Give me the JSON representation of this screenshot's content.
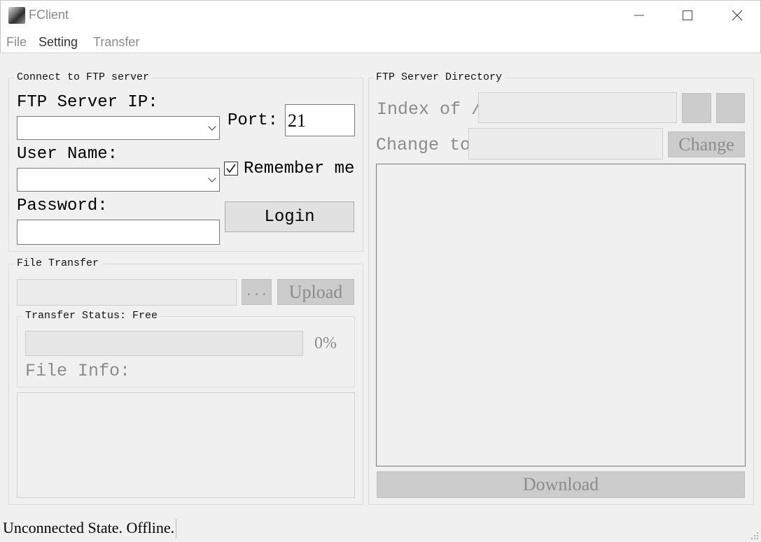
{
  "window": {
    "title": "FClient"
  },
  "menu": {
    "file": "File",
    "setting": "Setting",
    "transfer": "Transfer"
  },
  "connect": {
    "group_title": "Connect to FTP server",
    "ip_label": "FTP Server IP:",
    "ip_value": "",
    "port_label": "Port:",
    "port_value": "21",
    "username_label": "User Name:",
    "username_value": "",
    "remember_label": "Remember me",
    "remember_checked": true,
    "password_label": "Password:",
    "password_value": "",
    "login_label": "Login"
  },
  "file_transfer": {
    "group_title": "File Transfer",
    "file_path_value": "",
    "browse_label": "...",
    "upload_label": "Upload",
    "status_group_title": "Transfer Status: Free",
    "progress_percent_label": "0%",
    "progress_fraction": 0,
    "file_info_label": "File Info:"
  },
  "server_directory": {
    "group_title": "FTP Server Directory",
    "index_label": "Index of /",
    "index_value": "",
    "change_to_label": "Change to",
    "change_to_value": "",
    "change_button": "Change",
    "download_button": "Download"
  },
  "statusbar": {
    "text": "Unconnected State. Offline."
  },
  "colors": {
    "window_bg": "#f0f0f0",
    "disabled_text": "#8c8c8c",
    "disabled_button": "#cccccc"
  }
}
